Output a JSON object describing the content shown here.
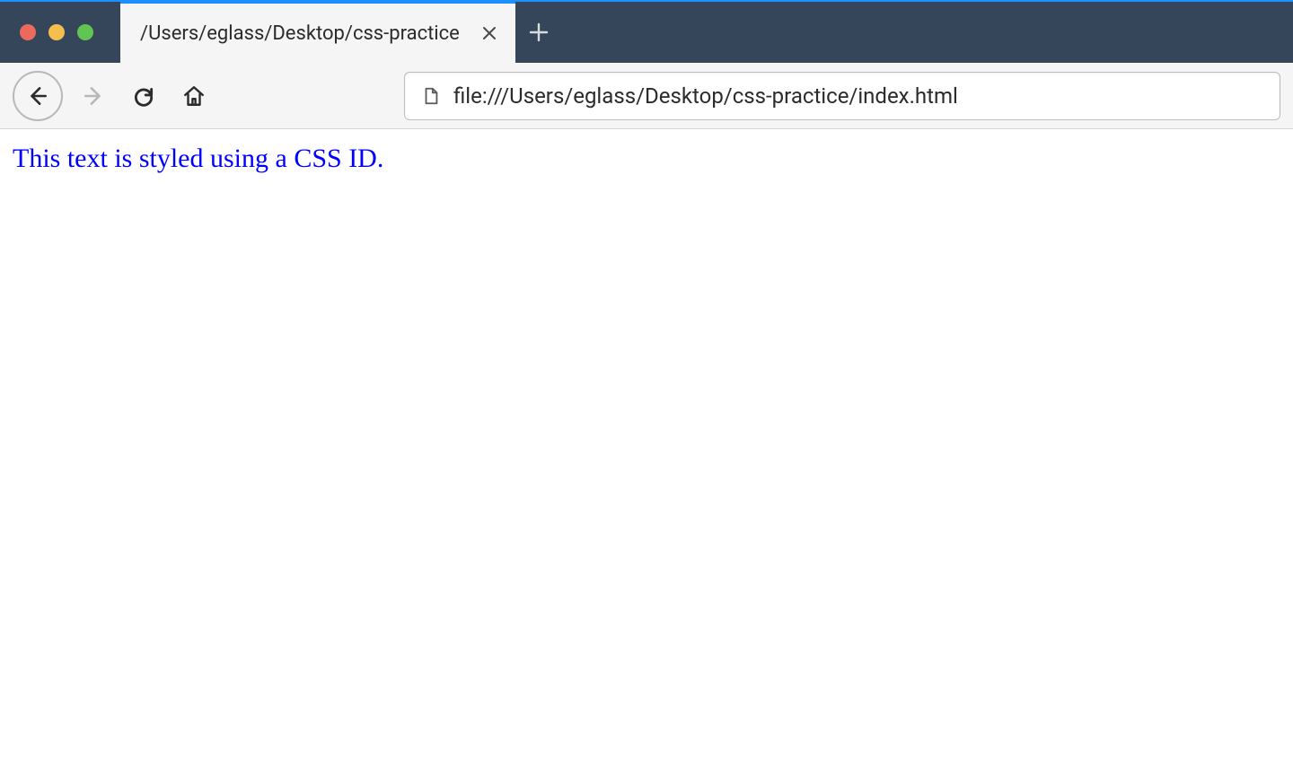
{
  "window": {
    "traffic_light_colors": {
      "red": "#ec695d",
      "yellow": "#f5bf4f",
      "green": "#61c554"
    }
  },
  "tabs": {
    "active": {
      "title": "/Users/eglass/Desktop/css-practice"
    }
  },
  "toolbar": {
    "url": "file:///Users/eglass/Desktop/css-practice/index.html"
  },
  "page": {
    "body_text": "This text is styled using a CSS ID."
  }
}
